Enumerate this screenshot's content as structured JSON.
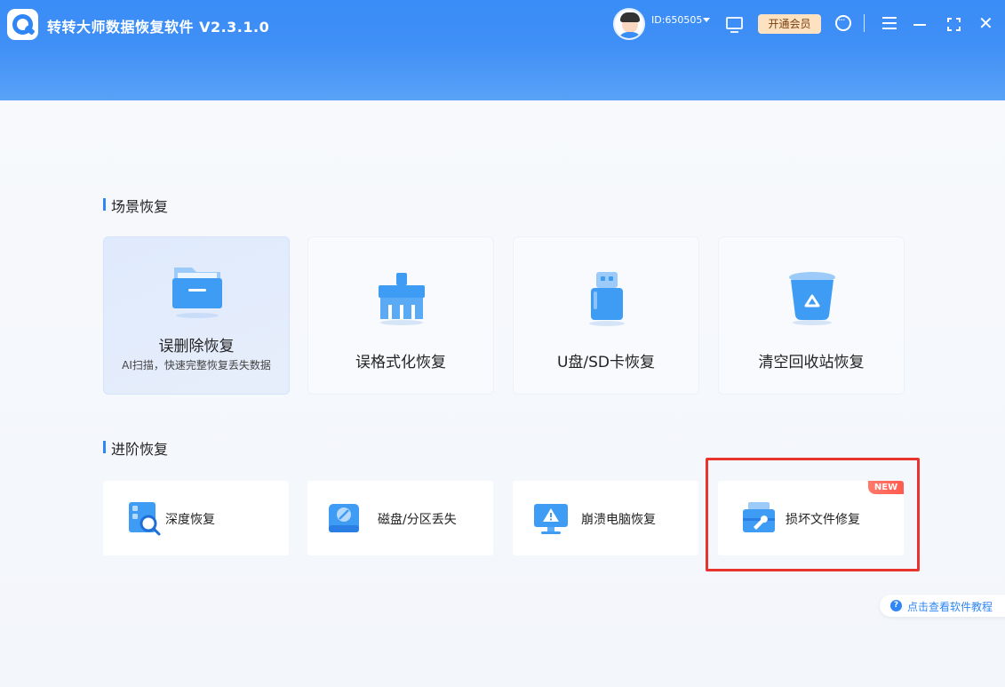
{
  "header": {
    "title": "转转大师数据恢复软件 V2.3.1.0",
    "user_id": "ID:650505",
    "vip_label": "开通会员"
  },
  "scene": {
    "title": "场景恢复",
    "cards": [
      {
        "label": "误删除恢复",
        "sub": "AI扫描，快速完整恢复丢失数据"
      },
      {
        "label": "误格式化恢复"
      },
      {
        "label": "U盘/SD卡恢复"
      },
      {
        "label": "清空回收站恢复"
      }
    ]
  },
  "advanced": {
    "title": "进阶恢复",
    "cards": [
      {
        "label": "深度恢复"
      },
      {
        "label": "磁盘/分区丢失"
      },
      {
        "label": "崩溃电脑恢复"
      },
      {
        "label": "损坏文件修复",
        "badge": "NEW"
      }
    ]
  },
  "help": {
    "label": "点击查看软件教程",
    "icon_char": "?"
  },
  "colors": {
    "accent": "#2f86f4",
    "highlight": "#e8342d",
    "badge": "#ff5a4f"
  }
}
